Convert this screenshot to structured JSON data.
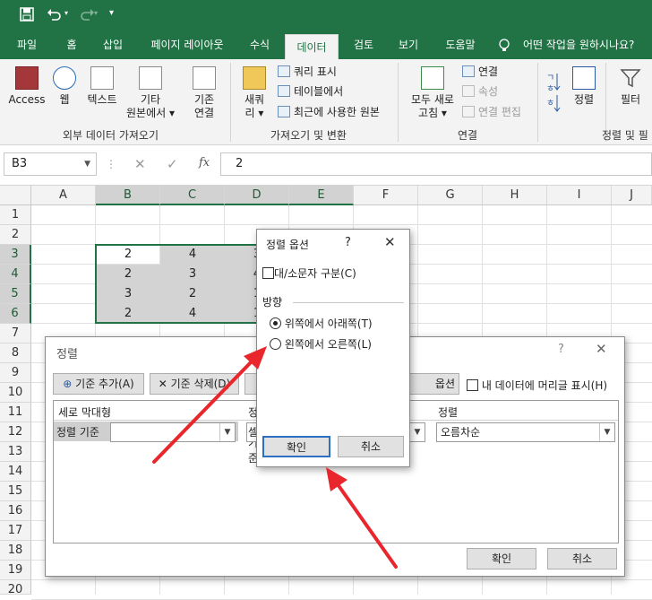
{
  "tabs": [
    "파일",
    "홈",
    "삽입",
    "페이지 레이아웃",
    "수식",
    "데이터",
    "검토",
    "보기",
    "도움말"
  ],
  "tell_me": "어떤 작업을 원하시나요?",
  "ribbon": {
    "access": "Access",
    "web": "웹",
    "text": "텍스트",
    "other1": "기타",
    "other2": "원본에서 ▾",
    "existing1": "기존",
    "existing2": "연결",
    "group1": "외부 데이터 가져오기",
    "new_query1": "새쿼",
    "new_query2": "리 ▾",
    "show_query": "쿼리 표시",
    "from_table": "테이블에서",
    "recent": "최근에 사용한 원본",
    "group2": "가져오기 및 변환",
    "refresh1": "모두 새로",
    "refresh2": "고침 ▾",
    "connections": "연결",
    "properties": "속성",
    "edit_links": "연결 편집",
    "group3": "연결",
    "sort": "정렬",
    "filter": "필터",
    "group4": "정렬 및 필"
  },
  "name_box": "B3",
  "formula_value": "2",
  "columns": [
    "A",
    "B",
    "C",
    "D",
    "E",
    "F",
    "G",
    "H",
    "I",
    "J"
  ],
  "rows": [
    "1",
    "2",
    "3",
    "4",
    "5",
    "6",
    "7",
    "8",
    "9",
    "10",
    "11",
    "12",
    "13",
    "14",
    "15",
    "16",
    "17",
    "18",
    "19",
    "20"
  ],
  "cells": {
    "b3": "2",
    "c3": "4",
    "d3": "3",
    "b4": "2",
    "c4": "3",
    "d4": "4",
    "b5": "3",
    "c5": "2",
    "d5": "1",
    "b6": "2",
    "c6": "4",
    "d6": "1"
  },
  "sort_dialog": {
    "title": "정렬",
    "help": "?",
    "add_level": "기준 추가(A)",
    "delete_level": "기준 삭제(D)",
    "options": "옵션(O)...",
    "header_checkbox": "내 데이터에 머리글 표시(H)",
    "col_header": "세로 막대형",
    "sort_on_header": "정렬 기준",
    "order_header": "정렬",
    "sort_by": "정렬 기준",
    "sort_on_value": "셀",
    "order_value": "오름차순",
    "ok": "확인",
    "cancel": "취소"
  },
  "options_dialog": {
    "title": "정렬 옵션",
    "help": "?",
    "case_sensitive": "대/소문자 구분(C)",
    "orientation": "방향",
    "top_to_bottom": "위쪽에서 아래쪽(T)",
    "left_to_right": "왼쪽에서 오른쪽(L)",
    "ok": "확인",
    "cancel": "취소"
  },
  "colors": {
    "excel_green": "#217346",
    "arrow": "#e8262b"
  }
}
